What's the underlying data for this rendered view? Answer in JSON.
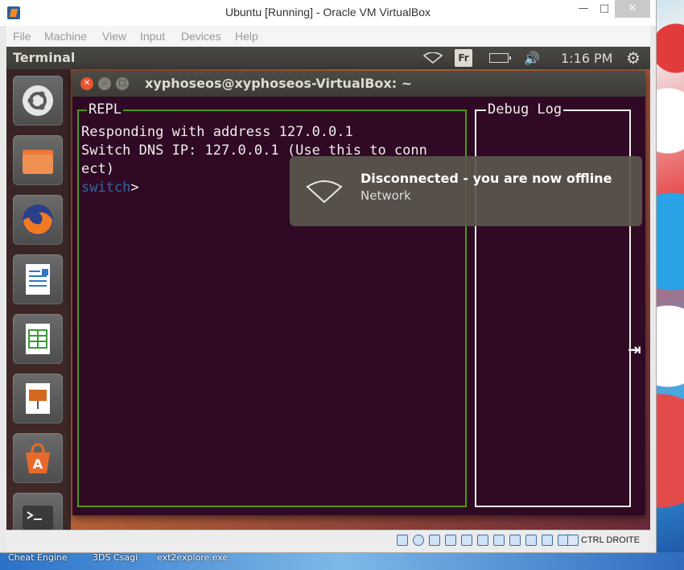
{
  "window": {
    "title": "Ubuntu [Running] - Oracle VM VirtualBox",
    "minimize": "—",
    "maximize": "□",
    "close": "✕"
  },
  "menu": [
    "File",
    "Machine",
    "View",
    "Input",
    "Devices",
    "Help"
  ],
  "ubuntu_topbar": {
    "app_title": "Terminal",
    "keyboard_layout": "Fr",
    "volume_glyph": "🔊",
    "time": "1:16 PM",
    "settings_glyph": "⚙"
  },
  "launcher": {
    "items": [
      {
        "icon": "ubuntu-logo-icon",
        "color": "#d9d9d9"
      },
      {
        "icon": "files-icon",
        "color": "#e8793a"
      },
      {
        "icon": "firefox-icon",
        "color": "#e8642a"
      },
      {
        "icon": "libreoffice-writer-icon",
        "color": "#2f78c5"
      },
      {
        "icon": "libreoffice-calc-icon",
        "color": "#3a9a3a"
      },
      {
        "icon": "libreoffice-impress-icon",
        "color": "#d2691e"
      },
      {
        "icon": "software-center-icon",
        "color": "#e86a2a"
      },
      {
        "icon": "terminal-icon",
        "color": "#3a3a3a"
      }
    ]
  },
  "terminal": {
    "title": "xyphoseos@xyphoseos-VirtualBox: ~",
    "close_glyph": "✕",
    "min_glyph": "–",
    "max_glyph": "□",
    "repl_label": "REPL",
    "lines": [
      "Responding with address 127.0.0.1",
      "Switch DNS IP: 127.0.0.1 (Use this to conn",
      "ect)"
    ],
    "prompt": "switch",
    "prompt_suffix": ">",
    "debug_label": "Debug Log"
  },
  "notification": {
    "title": "Disconnected - you are now offline",
    "body": "Network"
  },
  "statusbar": {
    "host_key": "CTRL DROITE"
  },
  "desktop": {
    "taskbar_items": [
      "Cheat Engine",
      "3DS Csagi",
      "ext2explore.exe"
    ]
  },
  "colors": {
    "terminal_bg": "#300a24",
    "repl_border": "#4e9a06",
    "prompt": "#3465a4",
    "ubuntu_panel": "#3c3b37"
  }
}
